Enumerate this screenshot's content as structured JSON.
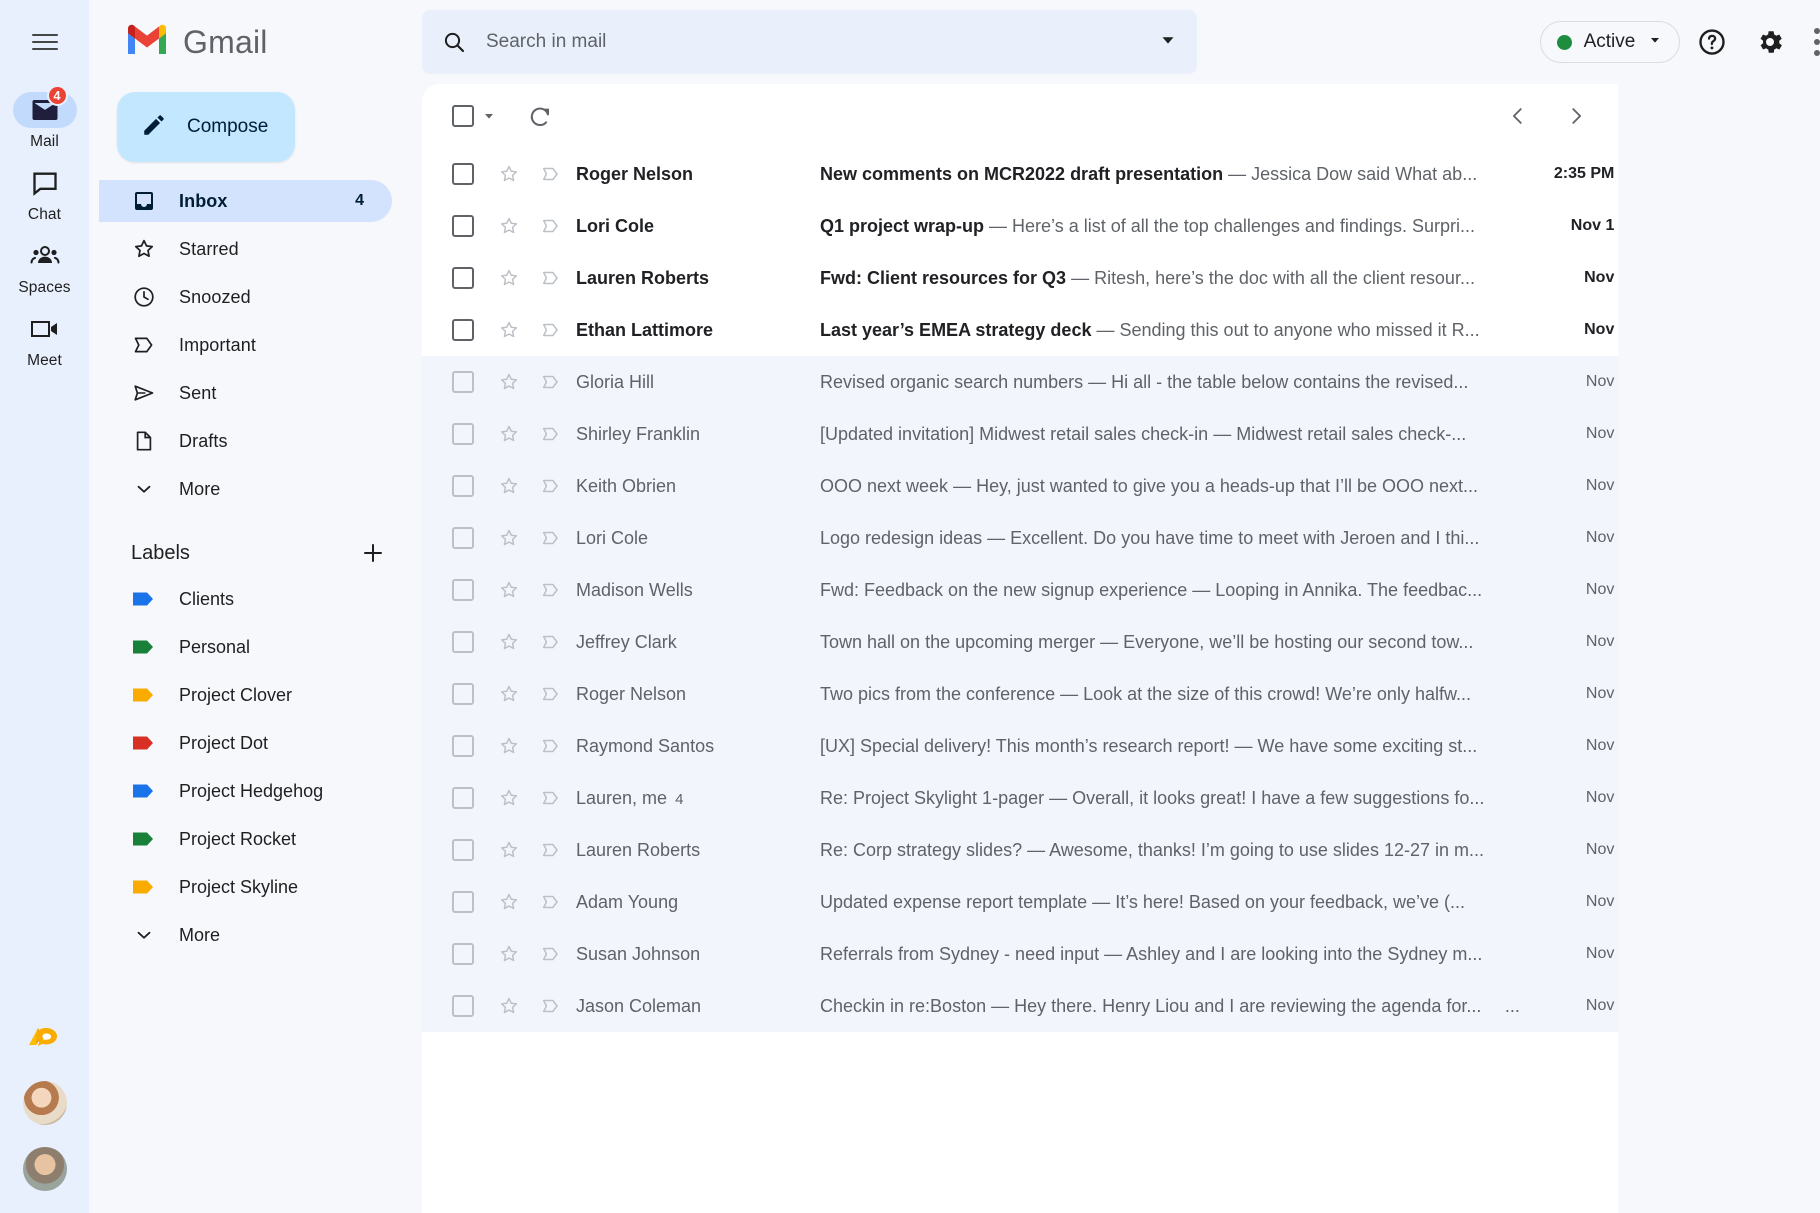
{
  "rail": {
    "menu_icon": "hamburger-menu-icon",
    "items": [
      {
        "label": "Mail",
        "icon": "mail-icon",
        "badge": "4",
        "active": true
      },
      {
        "label": "Chat",
        "icon": "chat-bubble-icon",
        "badge": "",
        "active": false
      },
      {
        "label": "Spaces",
        "icon": "spaces-people-icon",
        "badge": "",
        "active": false
      },
      {
        "label": "Meet",
        "icon": "meet-camera-icon",
        "badge": "",
        "active": false
      }
    ],
    "bottom": [
      {
        "name": "google-chat-apps-icon"
      },
      {
        "name": "avatar-contact-one"
      },
      {
        "name": "avatar-contact-two"
      }
    ]
  },
  "brand": {
    "logo": "gmail-logo-icon",
    "name": "Gmail"
  },
  "search": {
    "icon": "search-icon",
    "placeholder": "Search in mail",
    "value": "",
    "options_icon": "show-search-options-caret-icon"
  },
  "header_right": {
    "status_label": "Active",
    "status_color": "#1e8e3e",
    "status_caret": "chevron-down-icon",
    "help_icon": "help-question-icon",
    "settings_icon": "gear-icon",
    "apps_icon": "google-apps-grid-icon"
  },
  "sidebar": {
    "compose": {
      "label": "Compose",
      "icon": "pencil-compose-icon"
    },
    "nav": [
      {
        "label": "Inbox",
        "icon": "inbox-icon",
        "count": "4",
        "active": true
      },
      {
        "label": "Starred",
        "icon": "star-outline-icon",
        "count": "",
        "active": false
      },
      {
        "label": "Snoozed",
        "icon": "clock-icon",
        "count": "",
        "active": false
      },
      {
        "label": "Important",
        "icon": "important-chevron-icon",
        "count": "",
        "active": false
      },
      {
        "label": "Sent",
        "icon": "send-paperplane-icon",
        "count": "",
        "active": false
      },
      {
        "label": "Drafts",
        "icon": "draft-document-icon",
        "count": "",
        "active": false
      },
      {
        "label": "More",
        "icon": "chevron-down-icon",
        "count": "",
        "active": false
      }
    ],
    "labels_header": {
      "title": "Labels",
      "add_icon": "plus-icon"
    },
    "labels": [
      {
        "label": "Clients",
        "color": "#1a73e8"
      },
      {
        "label": "Personal",
        "color": "#188038"
      },
      {
        "label": "Project Clover",
        "color": "#f9ab00"
      },
      {
        "label": "Project Dot",
        "color": "#d93025"
      },
      {
        "label": "Project Hedgehog",
        "color": "#1a73e8"
      },
      {
        "label": "Project Rocket",
        "color": "#188038"
      },
      {
        "label": "Project Skyline",
        "color": "#f9ab00"
      }
    ],
    "labels_more": {
      "label": "More",
      "icon": "chevron-down-icon"
    }
  },
  "toolbar": {
    "select_all_icon": "select-all-checkbox",
    "select_caret_icon": "chevron-down-icon",
    "refresh_icon": "refresh-icon",
    "prev_icon": "chevron-left-icon",
    "next_icon": "chevron-right-icon"
  },
  "emails": [
    {
      "sender": "Roger Nelson",
      "count": "",
      "subject": "New comments on MCR2022 draft presentation",
      "snippet": "Jessica Dow said What ab...",
      "time": "2:35 PM",
      "unread": true,
      "dots": ""
    },
    {
      "sender": "Lori Cole",
      "count": "",
      "subject": "Q1 project wrap-up",
      "snippet": "Here’s a list of all the top challenges and findings. Surpri...",
      "time": "Nov 1",
      "unread": true,
      "dots": ""
    },
    {
      "sender": "Lauren Roberts",
      "count": "",
      "subject": "Fwd: Client resources for Q3",
      "snippet": "Ritesh, here’s the doc with all the client resour...",
      "time": "Nov",
      "unread": true,
      "dots": ""
    },
    {
      "sender": "Ethan Lattimore",
      "count": "",
      "subject": "Last year’s EMEA strategy deck",
      "snippet": "Sending this out to anyone who missed it R...",
      "time": "Nov",
      "unread": true,
      "dots": ""
    },
    {
      "sender": "Gloria Hill",
      "count": "",
      "subject": "Revised organic search numbers",
      "snippet": "Hi all - the table below contains the revised...",
      "time": "Nov",
      "unread": false,
      "dots": ""
    },
    {
      "sender": "Shirley Franklin",
      "count": "",
      "subject": "[Updated invitation] Midwest retail sales check-in",
      "snippet": "Midwest retail sales check-...",
      "time": "Nov",
      "unread": false,
      "dots": ""
    },
    {
      "sender": "Keith Obrien",
      "count": "",
      "subject": "OOO next week",
      "snippet": "Hey, just wanted to give you a heads-up that I’ll be OOO next...",
      "time": "Nov",
      "unread": false,
      "dots": ""
    },
    {
      "sender": "Lori Cole",
      "count": "",
      "subject": "Logo redesign ideas",
      "snippet": "Excellent. Do you have time to meet with Jeroen and I thi...",
      "time": "Nov",
      "unread": false,
      "dots": ""
    },
    {
      "sender": "Madison Wells",
      "count": "",
      "subject": "Fwd: Feedback on the new signup experience",
      "snippet": "Looping in Annika. The feedbac...",
      "time": "Nov",
      "unread": false,
      "dots": ""
    },
    {
      "sender": "Jeffrey Clark",
      "count": "",
      "subject": "Town hall on the upcoming merger",
      "snippet": "Everyone, we’ll be hosting our second tow...",
      "time": "Nov",
      "unread": false,
      "dots": ""
    },
    {
      "sender": "Roger Nelson",
      "count": "",
      "subject": "Two pics from the conference",
      "snippet": "Look at the size of this crowd! We’re only halfw...",
      "time": "Nov",
      "unread": false,
      "dots": ""
    },
    {
      "sender": "Raymond Santos",
      "count": "",
      "subject": "[UX] Special delivery! This month’s research report!",
      "snippet": "We have some exciting st...",
      "time": "Nov",
      "unread": false,
      "dots": ""
    },
    {
      "sender": "Lauren, me",
      "count": "4",
      "subject": "Re: Project Skylight 1-pager",
      "snippet": "Overall, it looks great! I have a few suggestions fo...",
      "time": "Nov",
      "unread": false,
      "dots": ""
    },
    {
      "sender": "Lauren Roberts",
      "count": "",
      "subject": "Re: Corp strategy slides?",
      "snippet": "Awesome, thanks! I’m going to use slides 12-27 in m...",
      "time": "Nov",
      "unread": false,
      "dots": ""
    },
    {
      "sender": "Adam Young",
      "count": "",
      "subject": "Updated expense report template",
      "snippet": "It’s here! Based on your feedback, we’ve (...",
      "time": "Nov",
      "unread": false,
      "dots": ""
    },
    {
      "sender": "Susan Johnson",
      "count": "",
      "subject": "Referrals from Sydney - need input",
      "snippet": "Ashley and I are looking into the Sydney m...",
      "time": "Nov",
      "unread": false,
      "dots": ""
    },
    {
      "sender": "Jason Coleman",
      "count": "",
      "subject": "Checkin in re:Boston",
      "snippet": "Hey there. Henry Liou and I are reviewing the agenda for...",
      "time": "Nov",
      "unread": false,
      "dots": "..."
    }
  ]
}
